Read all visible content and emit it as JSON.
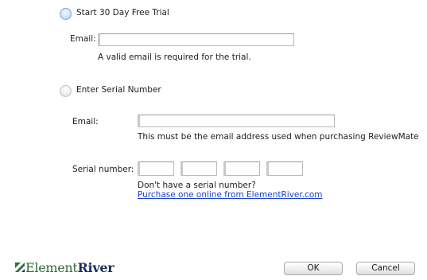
{
  "trial": {
    "radio_label": "Start 30 Day Free Trial",
    "selected": true,
    "email_label": "Email:",
    "email_value": "",
    "email_note": "A valid email is required for the trial."
  },
  "serial": {
    "radio_label": "Enter Serial Number",
    "selected": false,
    "email_label": "Email:",
    "email_value": "",
    "email_note": "This must be the email address used when purchasing ReviewMate",
    "serial_label": "Serial number:",
    "segments": [
      "",
      "",
      "",
      ""
    ],
    "no_serial_text": "Don't have a serial number?",
    "purchase_link": "Purchase one online from ElementRiver.com"
  },
  "footer": {
    "logo_word1": "Element",
    "logo_word2": "River",
    "ok_label": "OK",
    "cancel_label": "Cancel"
  },
  "colors": {
    "link": "#1b3fcf",
    "logo_green": "#2f6d3b",
    "logo_navy": "#1d2f5e"
  }
}
